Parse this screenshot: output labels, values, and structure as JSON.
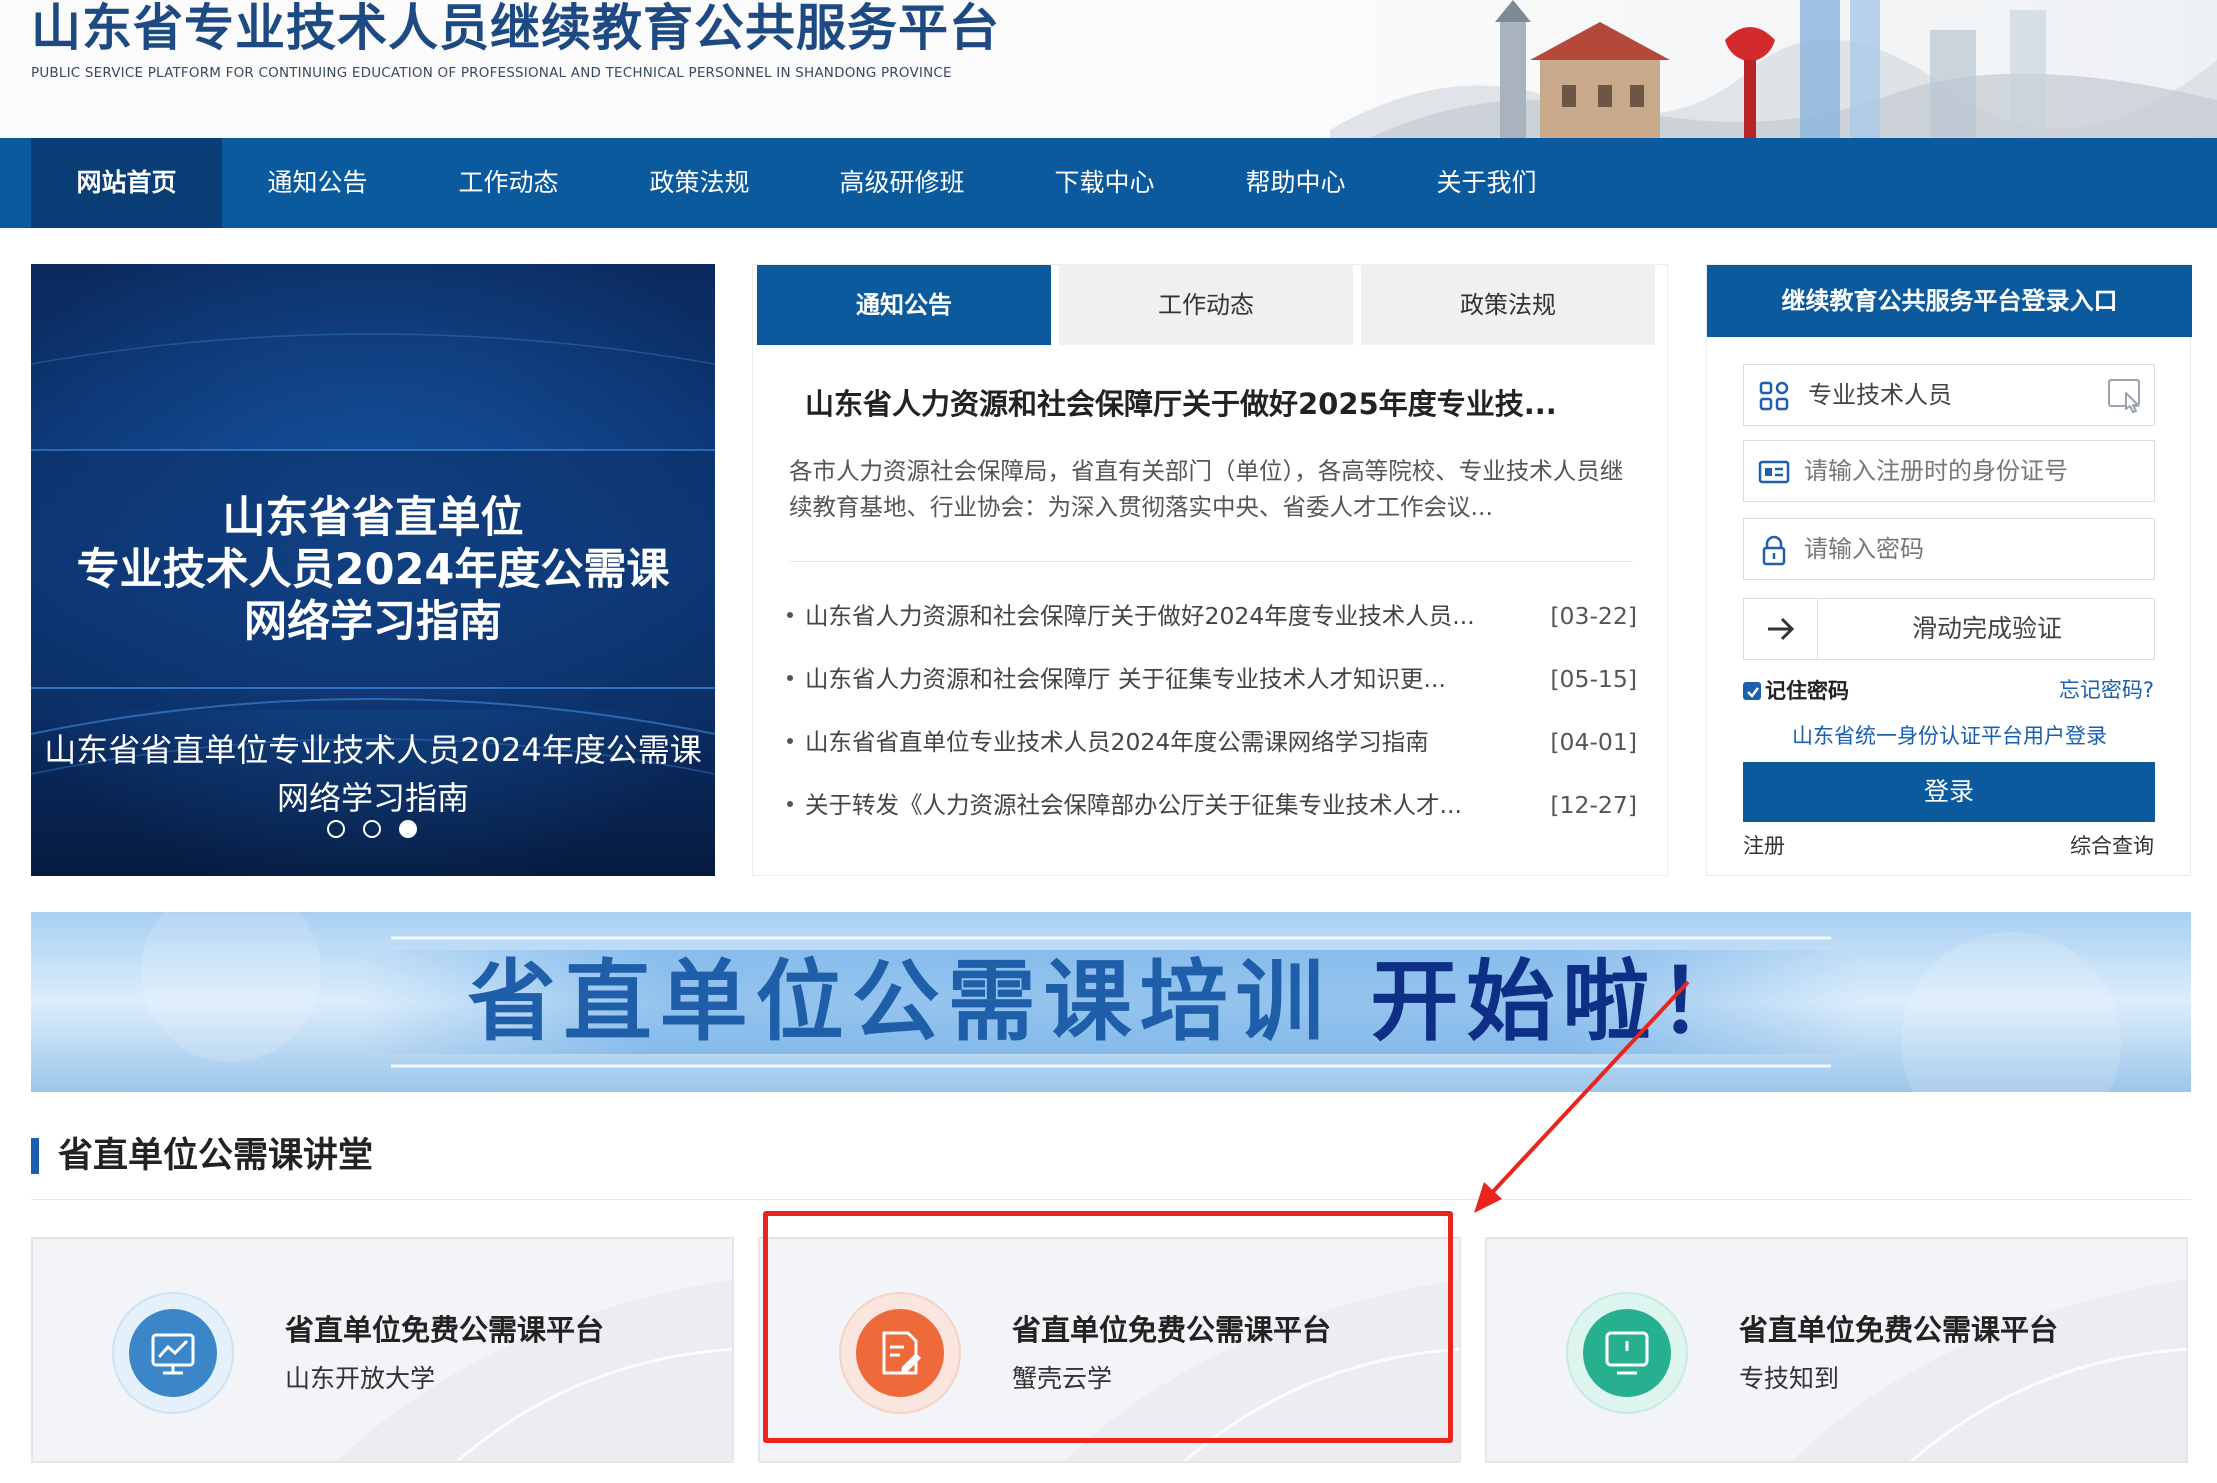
{
  "header": {
    "title": "山东省专业技术人员继续教育公共服务平台",
    "subtitle": "PUBLIC SERVICE PLATFORM FOR CONTINUING EDUCATION OF PROFESSIONAL AND TECHNICAL PERSONNEL IN SHANDONG PROVINCE"
  },
  "nav": {
    "items": [
      {
        "label": "网站首页",
        "active": true
      },
      {
        "label": "通知公告"
      },
      {
        "label": "工作动态"
      },
      {
        "label": "政策法规"
      },
      {
        "label": "高级研修班"
      },
      {
        "label": "下载中心"
      },
      {
        "label": "帮助中心"
      },
      {
        "label": "关于我们"
      }
    ]
  },
  "carousel": {
    "headline": [
      "山东省省直单位",
      "专业技术人员2024年度公需课",
      "网络学习指南"
    ],
    "caption": [
      "山东省省直单位专业技术人员2024年度公需课",
      "网络学习指南"
    ],
    "slide_count": 3,
    "active_slide": 3
  },
  "news": {
    "tabs": [
      "通知公告",
      "工作动态",
      "政策法规"
    ],
    "active_tab": 0,
    "featured": {
      "title": "山东省人力资源和社会保障厅关于做好2025年度专业技...",
      "summary": "各市人力资源社会保障局，省直有关部门（单位），各高等院校、专业技术人员继续教育基地、行业协会：为深入贯彻落实中央、省委人才工作会议..."
    },
    "items": [
      {
        "title": "山东省人力资源和社会保障厅关于做好2024年度专业技术人员...",
        "date": "[03-22]"
      },
      {
        "title": "山东省人力资源和社会保障厅 关于征集专业技术人才知识更...",
        "date": "[05-15]"
      },
      {
        "title": "山东省省直单位专业技术人员2024年度公需课网络学习指南",
        "date": "[04-01]"
      },
      {
        "title": "关于转发《人力资源社会保障部办公厅关于征集专业技术人才...",
        "date": "[12-27]"
      }
    ]
  },
  "login": {
    "title": "继续教育公共服务平台登录入口",
    "role_label": "专业技术人员",
    "id_placeholder": "请输入注册时的身份证号",
    "password_placeholder": "请输入密码",
    "slider_text": "滑动完成验证",
    "remember_label": "记住密码",
    "remember_checked": true,
    "forgot_label": "忘记密码?",
    "unified_login": "山东省统一身份认证平台用户登录",
    "submit_label": "登录",
    "register_label": "注册",
    "query_label": "综合查询"
  },
  "banner": {
    "main_text": "省直单位公需课培训",
    "accent_text": "开始啦！"
  },
  "section": {
    "title": "省直单位公需课讲堂"
  },
  "cards": [
    {
      "title": "省直单位免费公需课平台",
      "provider": "山东开放大学",
      "icon": "chart-icon",
      "color": "#3a86c8"
    },
    {
      "title": "省直单位免费公需课平台",
      "provider": "蟹壳云学",
      "icon": "edit-document-icon",
      "color": "#ef6a3a"
    },
    {
      "title": "省直单位免费公需课平台",
      "provider": "专技知到",
      "icon": "monitor-icon",
      "color": "#27b08f"
    }
  ],
  "colors": {
    "primary": "#0c5a9e",
    "nav_active": "#0a3c76",
    "link": "#1a5fb0",
    "annotation": "#e8261f"
  }
}
